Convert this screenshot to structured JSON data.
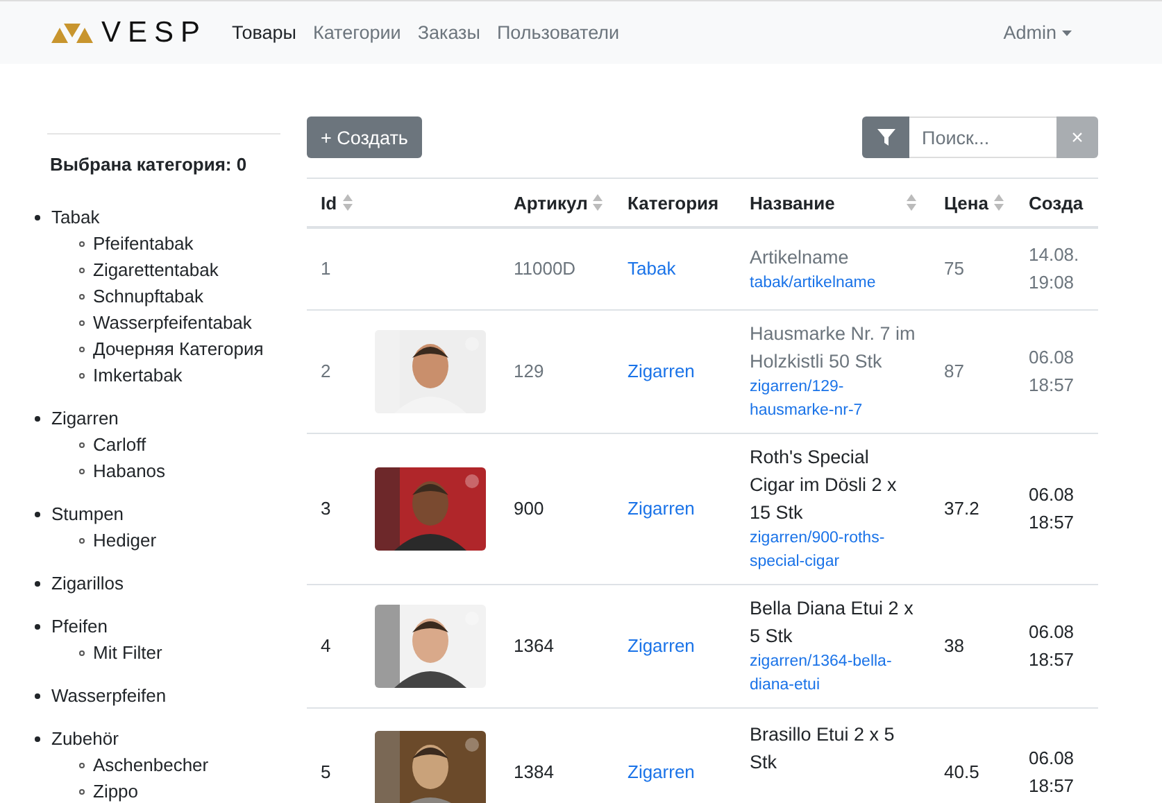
{
  "navbar": {
    "logo": "VESP",
    "links": [
      {
        "label": "Товары",
        "selected": true
      },
      {
        "label": "Категории",
        "selected": false
      },
      {
        "label": "Заказы",
        "selected": false
      },
      {
        "label": "Пользователи",
        "selected": false
      }
    ],
    "user_menu": "Admin"
  },
  "sidebar": {
    "title": "Выбрана категория: 0",
    "categories": [
      {
        "label": "Tabak",
        "children": [
          {
            "label": "Pfeifentabak"
          },
          {
            "label": "Zigarettentabak"
          },
          {
            "label": "Schnupftabak"
          },
          {
            "label": "Wasserpfeifentabak"
          },
          {
            "label": "Дочерняя Категория"
          },
          {
            "label": "Imkertabak"
          }
        ]
      },
      {
        "label": "Zigarren",
        "children": [
          {
            "label": "Carloff"
          },
          {
            "label": "Habanos"
          }
        ]
      },
      {
        "label": "Stumpen",
        "children": [
          {
            "label": "Hediger"
          }
        ]
      },
      {
        "label": "Zigarillos"
      },
      {
        "label": "Pfeifen",
        "children": [
          {
            "label": "Mit Filter"
          }
        ]
      },
      {
        "label": "Wasserpfeifen"
      },
      {
        "label": "Zubehör",
        "children": [
          {
            "label": "Aschenbecher"
          },
          {
            "label": "Zippo"
          }
        ]
      }
    ]
  },
  "toolbar": {
    "create_button": "+ Создать",
    "search": {
      "placeholder": "Поиск..."
    },
    "clear_button": "×"
  },
  "table": {
    "columns": [
      {
        "label": "Id",
        "sortable": true
      },
      {
        "sortable": false
      },
      {
        "label": "Артикул",
        "sortable": true
      },
      {
        "label": "Категория",
        "sortable": false
      },
      {
        "label": "Название",
        "sortable": true
      },
      {
        "label": "Цена",
        "sortable": true
      },
      {
        "label": "Созда",
        "sortable": false
      }
    ],
    "rows": [
      {
        "id": "1",
        "has_picture": false,
        "article": "11000D",
        "category": "Tabak",
        "name": "Artikelname",
        "slug": "tabak/artikelname",
        "price": "75",
        "date": "14.08.",
        "time": "19:08",
        "inactive": true
      },
      {
        "id": "2",
        "has_picture": true,
        "article": "129",
        "category": "Zigarren",
        "name": "Hausmarke Nr. 7 im Holzkistli 50 Stk",
        "slug": "zigarren/129-hausmarke-nr-7",
        "price": "87",
        "date": "06.08",
        "time": "18:57",
        "inactive": true
      },
      {
        "id": "3",
        "has_picture": true,
        "article": "900",
        "category": "Zigarren",
        "name": "Roth's Special Cigar im Dösli 2 x 15 Stk",
        "slug": "zigarren/900-roths-special-cigar",
        "price": "37.2",
        "date": "06.08",
        "time": "18:57",
        "inactive": false
      },
      {
        "id": "4",
        "has_picture": true,
        "article": "1364",
        "category": "Zigarren",
        "name": "Bella Diana Etui 2 x 5 Stk",
        "slug": "zigarren/1364-bella-diana-etui",
        "price": "38",
        "date": "06.08",
        "time": "18:57",
        "inactive": false
      },
      {
        "id": "5",
        "has_picture": true,
        "article": "1384",
        "category": "Zigarren",
        "name": "Brasillo Etui 2 x 5 Stk",
        "price": "40.5",
        "date": "06.08",
        "time": "18:57",
        "inactive": false
      }
    ]
  }
}
